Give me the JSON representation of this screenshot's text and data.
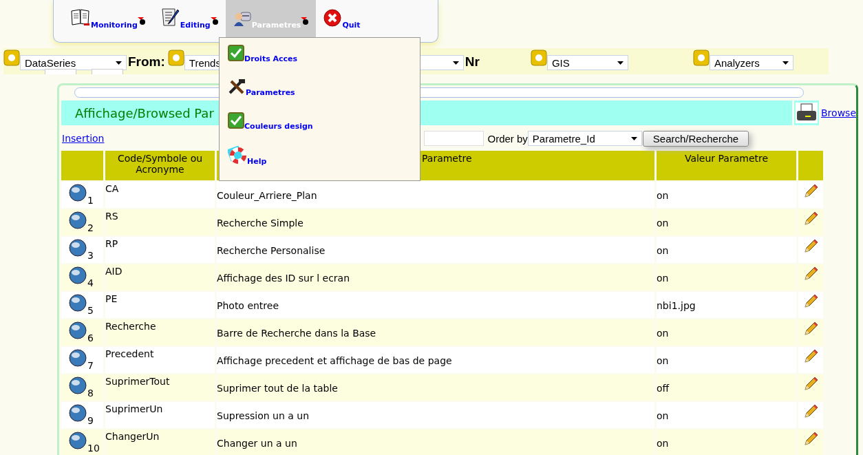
{
  "menu": {
    "items": [
      {
        "label": "Monitoring",
        "kind": "book",
        "selected": false,
        "has_submenu": true
      },
      {
        "label": "Editing",
        "kind": "scroll",
        "selected": false,
        "has_submenu": true
      },
      {
        "label": "Parametres",
        "kind": "admin",
        "selected": true,
        "has_submenu": true
      },
      {
        "label": "Quit",
        "kind": "quit",
        "selected": false,
        "has_submenu": false
      }
    ],
    "dropdown": [
      {
        "label": "Droits Acces",
        "kind": "check"
      },
      {
        "label": "Parametres",
        "kind": "tools"
      },
      {
        "label": "Couleurs design",
        "kind": "check"
      },
      {
        "label": "Help",
        "kind": "lifebuoy"
      }
    ]
  },
  "filters": {
    "series_select": "DataSeries",
    "from_label": "From:",
    "from_select": "Trends",
    "nr_label": "Nr",
    "gis_select": "GIS",
    "analyzers_select": "Analyzers"
  },
  "panel": {
    "title": "Affichage/Browsed Par",
    "browse_link": "Browse",
    "insertion_link": "Insertion",
    "order_label": "Order by",
    "order_select": "Parametre_Id",
    "search_button": "Search/Recherche"
  },
  "table": {
    "columns": [
      "Code/Symbole ou Acronyme",
      "Parametre",
      "Valeur Parametre"
    ],
    "rows": [
      {
        "number": "1",
        "code": "CA",
        "parametre": "Couleur_Arriere_Plan",
        "valeur": "on"
      },
      {
        "number": "2",
        "code": "RS",
        "parametre": "Recherche Simple",
        "valeur": "on"
      },
      {
        "number": "3",
        "code": "RP",
        "parametre": "Recherche Personalise",
        "valeur": "on"
      },
      {
        "number": "4",
        "code": "AID",
        "parametre": "Affichage des ID sur l ecran",
        "valeur": "on"
      },
      {
        "number": "5",
        "code": "PE",
        "parametre": "Photo entree",
        "valeur": "nbi1.jpg"
      },
      {
        "number": "6",
        "code": "Recherche",
        "parametre": "Barre de Recherche dans la Base",
        "valeur": "on"
      },
      {
        "number": "7",
        "code": "Precedent",
        "parametre": "Affichage precedent et affichage de bas de page",
        "valeur": "on"
      },
      {
        "number": "8",
        "code": "SuprimerTout",
        "parametre": "Suprimer tout de la table",
        "valeur": "off"
      },
      {
        "number": "9",
        "code": "SuprimerUn",
        "parametre": "Supression un a un",
        "valeur": "on"
      },
      {
        "number": "10",
        "code": "ChangerUn",
        "parametre": "Changer un a un",
        "valeur": "on"
      }
    ]
  }
}
